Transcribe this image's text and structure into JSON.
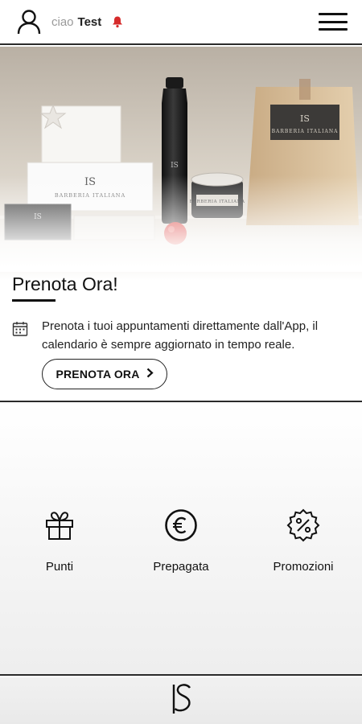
{
  "header": {
    "greeting": "ciao",
    "username": "Test",
    "icons": [
      "user-icon",
      "bell-icon",
      "menu-icon"
    ],
    "bell_color": "#d62b2b"
  },
  "hero": {
    "title": "Prenota Ora!",
    "description": "Prenota i tuoi appuntamenti direttamente dall'App, il calendario è sempre aggiornato in tempo reale.",
    "button_label": "PRENOTA ORA",
    "product_label": "BARBERIA ITALIANA",
    "logo_text": "IS"
  },
  "features": [
    {
      "label": "Punti",
      "icon": "gift-icon"
    },
    {
      "label": "Prepagata",
      "icon": "euro-icon"
    },
    {
      "label": "Promozioni",
      "icon": "percent-badge-icon"
    }
  ],
  "footer": {
    "logo_text": "IS"
  }
}
